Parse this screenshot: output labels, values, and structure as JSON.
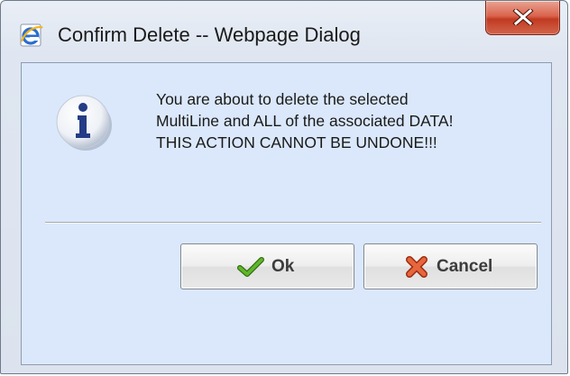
{
  "window": {
    "title": "Confirm Delete -- Webpage Dialog",
    "app_icon": "internet-explorer-icon",
    "close_icon": "close-icon"
  },
  "dialog": {
    "icon": "info-icon",
    "message_lines": [
      "You are about to delete the selected",
      "MultiLine and ALL of the associated DATA!",
      "THIS ACTION CANNOT BE UNDONE!!!"
    ]
  },
  "buttons": {
    "ok_label": "Ok",
    "ok_icon": "checkmark-icon",
    "cancel_label": "Cancel",
    "cancel_icon": "cross-icon"
  },
  "colors": {
    "client_bg": "#dbe8fb",
    "close_button": "#c03a21",
    "check_green": "#4a9a1c",
    "cross_red": "#d9532e",
    "info_blue": "#243c86"
  }
}
